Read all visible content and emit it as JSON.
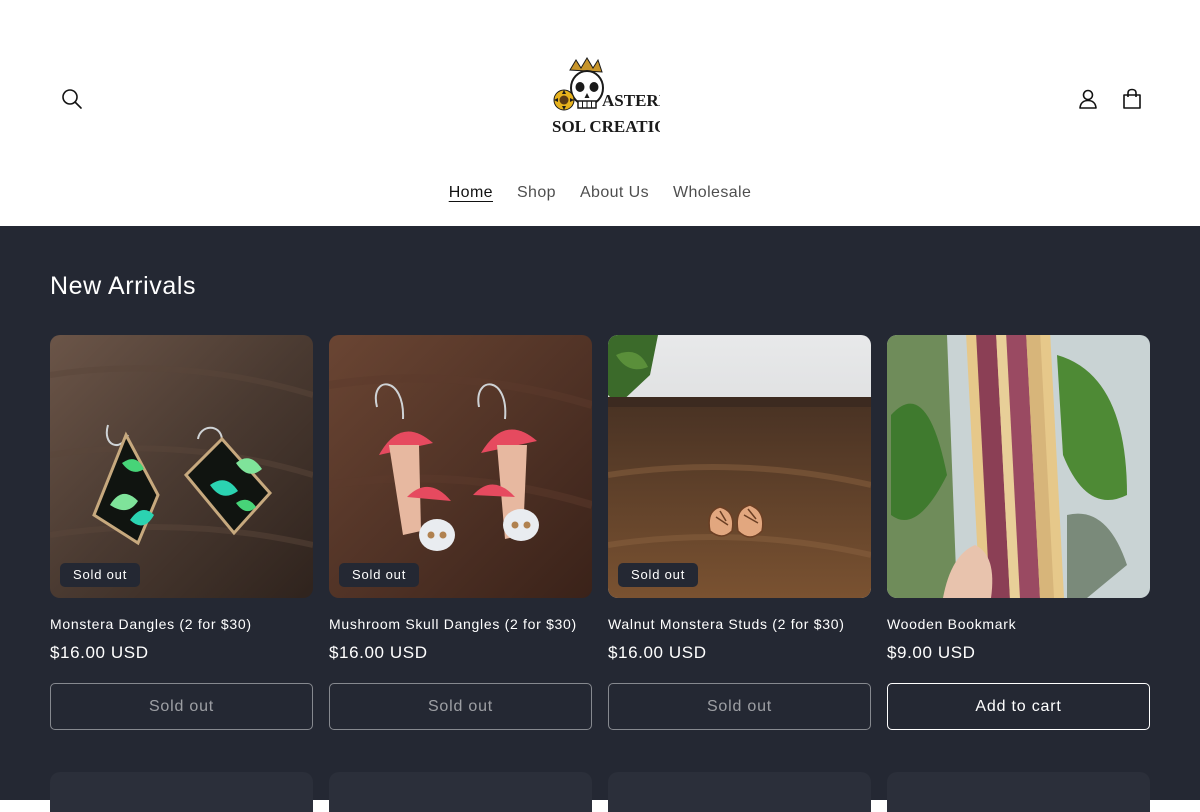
{
  "header": {
    "logo": {
      "line1": "ASTERIA",
      "line2": "SOL CREATIONS"
    },
    "nav": [
      {
        "label": "Home"
      },
      {
        "label": "Shop"
      },
      {
        "label": "About Us"
      },
      {
        "label": "Wholesale"
      }
    ],
    "icons": {
      "search": "search-icon",
      "account": "user-icon",
      "cart": "bag-icon"
    }
  },
  "section": {
    "title": "New Arrivals",
    "products": [
      {
        "title": "Monstera Dangles (2 for $30)",
        "price": "$16.00 USD",
        "badge": "Sold out",
        "button": "Sold out"
      },
      {
        "title": "Mushroom Skull Dangles (2 for $30)",
        "price": "$16.00 USD",
        "badge": "Sold out",
        "button": "Sold out"
      },
      {
        "title": "Walnut Monstera Studs (2 for $30)",
        "price": "$16.00 USD",
        "badge": "Sold out",
        "button": "Sold out"
      },
      {
        "title": "Wooden Bookmark",
        "price": "$9.00 USD",
        "button": "Add to cart"
      }
    ]
  },
  "colors": {
    "section_bg": "#242833",
    "text_light": "#ffffff",
    "header_bg": "#ffffff"
  }
}
